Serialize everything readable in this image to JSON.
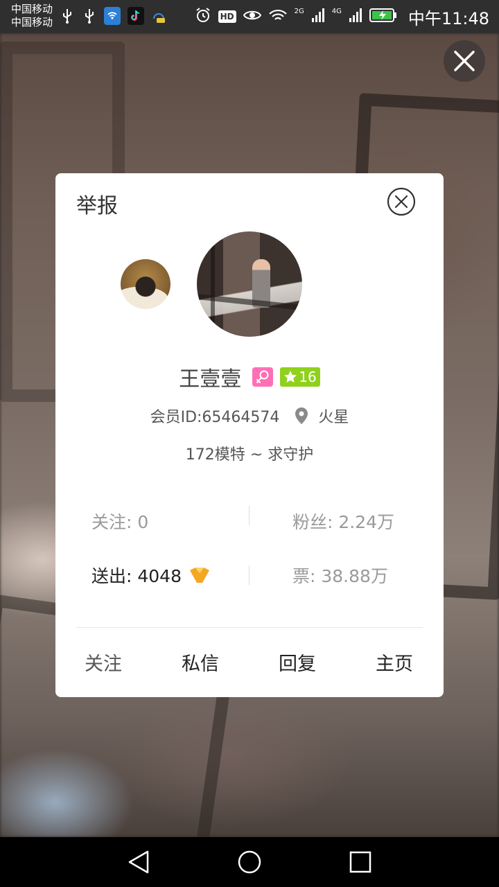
{
  "status_bar": {
    "carrier_1": "中国移动",
    "carrier_2": "中国移动",
    "hd": "HD",
    "net_1": "2G",
    "net_2": "4G",
    "time": "中午11:48",
    "icons": [
      "usb-icon",
      "usb-icon",
      "wifi-hotspot-icon",
      "tiktok-icon",
      "notification-icon",
      "alarm-icon",
      "eye-icon",
      "wifi-icon",
      "signal-icon",
      "signal-icon",
      "battery-charging-icon"
    ]
  },
  "dialog": {
    "report_label": "举报",
    "user": {
      "name": "王壹壹",
      "level": "16",
      "member_id": "会员ID:65464574",
      "location": "火星",
      "signature": "172模特 ~ 求守护"
    },
    "stats": {
      "following": "关注: 0",
      "fans": "粉丝: 2.24万",
      "sent": "送出: 4048",
      "tickets": "票: 38.88万"
    },
    "actions": {
      "follow": "关注",
      "message": "私信",
      "reply": "回复",
      "home": "主页"
    }
  },
  "colors": {
    "gender_badge": "#ff6fb6",
    "level_badge": "#8fd11c",
    "gift_icon": "#f5a623"
  }
}
